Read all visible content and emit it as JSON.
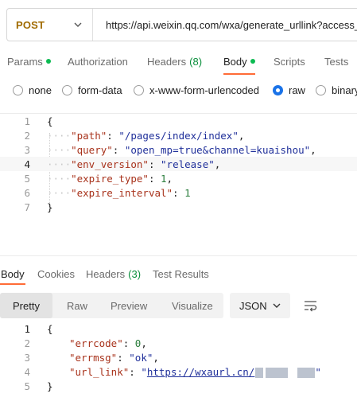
{
  "request": {
    "method": "POST",
    "url": "https://api.weixin.qq.com/wxa/generate_urllink?access_"
  },
  "request_tabs": [
    {
      "label": "Params",
      "dot": true
    },
    {
      "label": "Authorization"
    },
    {
      "label": "Headers",
      "count": "(8)"
    },
    {
      "label": "Body",
      "dot": true,
      "active": true
    },
    {
      "label": "Scripts"
    },
    {
      "label": "Tests"
    }
  ],
  "body_types": [
    {
      "label": "none",
      "selected": false
    },
    {
      "label": "form-data",
      "selected": false
    },
    {
      "label": "x-www-form-urlencoded",
      "selected": false
    },
    {
      "label": "raw",
      "selected": true
    },
    {
      "label": "binary",
      "selected": false
    }
  ],
  "request_body": {
    "line_numbers": [
      "1",
      "2",
      "3",
      "4",
      "5",
      "6",
      "7"
    ],
    "open_brace": "{",
    "close_brace": "}",
    "fields": [
      {
        "key": "\"path\"",
        "value": "\"/pages/index/index\"",
        "type": "string"
      },
      {
        "key": "\"query\"",
        "value": "\"open_mp=true&channel=kuaishou\"",
        "type": "string"
      },
      {
        "key": "\"env_version\"",
        "value": "\"release\"",
        "type": "string"
      },
      {
        "key": "\"expire_type\"",
        "value": "1",
        "type": "number"
      },
      {
        "key": "\"expire_interval\"",
        "value": "1",
        "type": "number"
      }
    ]
  },
  "response_tabs": [
    {
      "label": "Body",
      "active": true
    },
    {
      "label": "Cookies"
    },
    {
      "label": "Headers",
      "count": "(3)"
    },
    {
      "label": "Test Results"
    }
  ],
  "view_modes": [
    {
      "label": "Pretty",
      "active": true
    },
    {
      "label": "Raw"
    },
    {
      "label": "Preview"
    },
    {
      "label": "Visualize"
    }
  ],
  "format": "JSON",
  "response_body": {
    "line_numbers": [
      "1",
      "2",
      "3",
      "4",
      "5"
    ],
    "open_brace": "{",
    "close_brace": "}",
    "fields": [
      {
        "key": "\"errcode\"",
        "value": "0",
        "type": "number"
      },
      {
        "key": "\"errmsg\"",
        "value": "\"ok\"",
        "type": "string"
      },
      {
        "key": "\"url_link\"",
        "value_quote_open": "\"",
        "value_link": "https://wxaurl.cn/",
        "value_quote_close": "\"",
        "type": "link"
      }
    ]
  },
  "colors": {
    "accent": "#ff6c37",
    "method": "#a06b00",
    "dot": "#0cbb52",
    "key": "#a8321b",
    "string": "#1f2f9a",
    "number": "#2a7d3c",
    "radio_selected": "#1a73e8"
  },
  "icons": {
    "method_dropdown": "chevron-down-icon",
    "format_dropdown": "chevron-down-icon",
    "wrap": "text-wrap-icon"
  }
}
